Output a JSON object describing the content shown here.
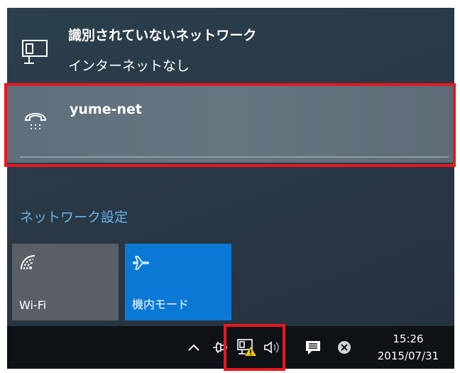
{
  "networks": [
    {
      "name": "識別されていないネットワーク",
      "status": "インターネットなし",
      "icon": "wired-ethernet-icon"
    },
    {
      "name": "yume-net",
      "icon": "dialup-phone-icon",
      "selected": true
    }
  ],
  "network_settings_link": "ネットワーク設定",
  "quick_actions": [
    {
      "label": "Wi-Fi",
      "icon": "wifi-icon",
      "active": false
    },
    {
      "label": "機内モード",
      "icon": "airplane-icon",
      "active": true
    }
  ],
  "taskbar": {
    "tray_icons": [
      "chevron-up-icon",
      "power-plug-icon",
      "network-warning-icon",
      "volume-icon",
      "action-center-icon",
      "close-circle-icon"
    ],
    "time": "15:26",
    "date": "2015/07/31"
  },
  "colors": {
    "flyout_bg": "#2a3946",
    "selected_item_bg": "#667681",
    "link": "#67b2ec",
    "tile_inactive": "#595f64",
    "tile_active": "#0a79d6",
    "highlight": "#e8171f",
    "warning": "#f5c400"
  }
}
